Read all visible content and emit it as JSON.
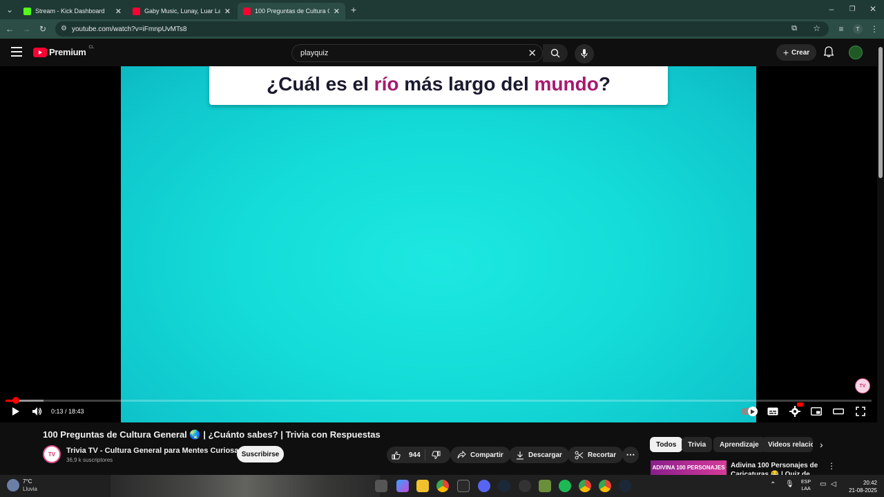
{
  "browser": {
    "tabs": [
      {
        "title": "Stream - Kick Dashboard",
        "favicon_color": "#53fc18",
        "favicon": "kick-icon"
      },
      {
        "title": "Gaby Music, Lunay, Luar La L - ",
        "favicon_color": "#ff0033",
        "favicon": "youtube-icon"
      },
      {
        "title": "100 Preguntas de Cultura Gene",
        "favicon_color": "#ff0033",
        "favicon": "youtube-icon"
      }
    ],
    "url": "youtube.com/watch?v=iFmnpUvMTs8",
    "profile_initial": "T"
  },
  "youtube": {
    "logo_text": "Premium",
    "region": "CL",
    "search_value": "playquiz",
    "create_label": "Crear"
  },
  "player": {
    "question_parts": {
      "p1": "¿Cuál es el ",
      "h1": "río",
      "p2": " más largo del ",
      "h2": "mundo",
      "p3": "?"
    },
    "time": "0:13 / 18:43",
    "progress_fraction": 0.0116,
    "buffer_fraction": 0.044
  },
  "video": {
    "title": "100 Preguntas de Cultura General 🌏 | ¿Cuánto sabes? | Trivia con Respuestas",
    "channel_name": "Trivia TV - Cultura General para Mentes Curiosas",
    "channel_avatar_text": "TV",
    "subscribers": "36,9 k suscriptores",
    "subscribe_label": "Suscribirse",
    "likes": "944",
    "share_label": "Compartir",
    "download_label": "Descargar",
    "clip_label": "Recortar"
  },
  "sidebar": {
    "chips": [
      "Todos",
      "Trivia",
      "Aprendizaje",
      "Videos relacio"
    ],
    "rec_thumb_text": "ADIVINA 100 PERSONAJES",
    "rec_title": "Adivina 100 Personajes de Caricaturas 😂 | Quiz de"
  },
  "taskbar": {
    "temperature": "7°C",
    "condition": "Lluvia",
    "lang_top": "ESP",
    "lang_bottom": "LAA",
    "time": "20:42",
    "date": "21-08-2025"
  }
}
